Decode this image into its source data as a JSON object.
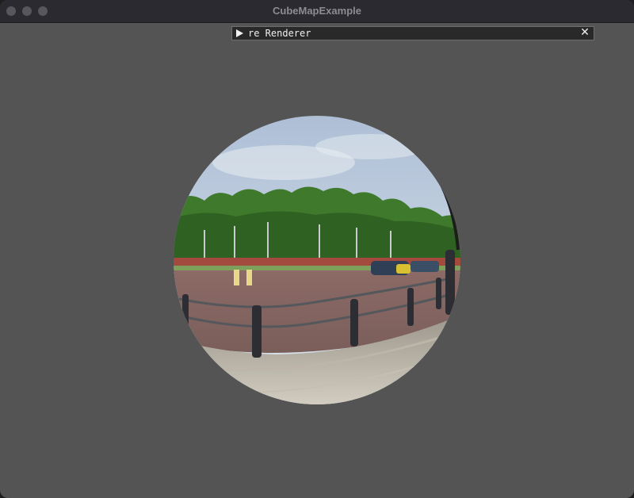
{
  "window": {
    "title": "CubeMapExample",
    "controls": [
      "close",
      "minimize",
      "maximize"
    ]
  },
  "panel": {
    "title": "re Renderer",
    "collapse_icon": "triangle-right-icon",
    "close_glyph": "✕",
    "close_icon": "close-icon"
  },
  "scene": {
    "object": "reflective sphere with cube map environment",
    "colors": {
      "background": "#545454",
      "titlebar": "#2b2a30",
      "panel": "#292929"
    }
  }
}
